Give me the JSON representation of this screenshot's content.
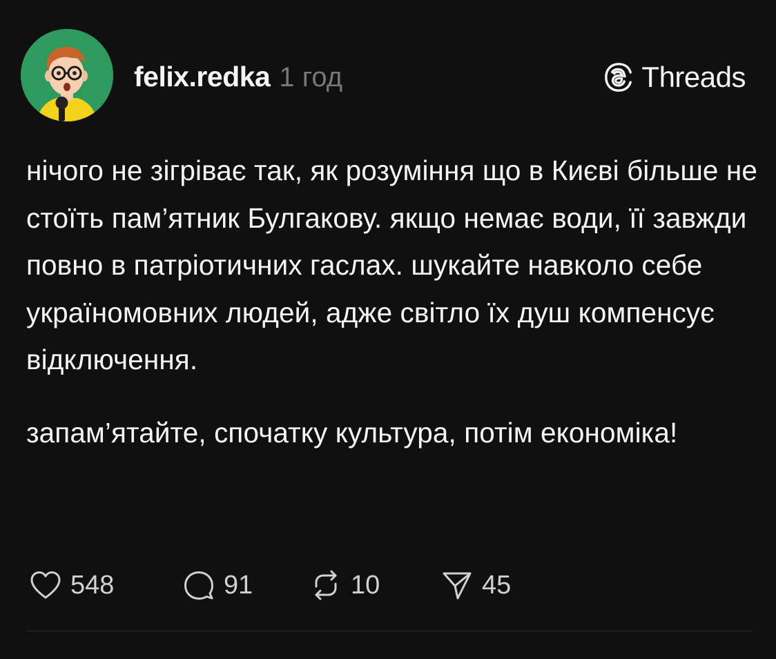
{
  "post": {
    "username": "felix.redka",
    "time": "1 год",
    "brand": {
      "name": "Threads",
      "icon": "threads-logo-icon"
    },
    "avatar_icon": "cartoon-avatar-icon",
    "paragraphs": [
      "нічого не зігріває так, як розуміння що в Києві більше не стоїть пам’ятник Булгакову. якщо немає води, її завжди повно в патріотичних гаслах. шукайте навколо себе україномовних людей, адже світло їх душ компенсує відключення.",
      "запам’ятайте, спочатку культура, потім економіка!"
    ],
    "actions": {
      "likes": {
        "icon": "heart-icon",
        "count": "548"
      },
      "replies": {
        "icon": "comment-icon",
        "count": "91"
      },
      "reposts": {
        "icon": "repost-icon",
        "count": "10"
      },
      "shares": {
        "icon": "share-icon",
        "count": "45"
      }
    }
  },
  "colors": {
    "background": "#101010",
    "text": "#f3f5f7",
    "muted": "#777777",
    "avatar_bg": "#2f9a5e"
  }
}
